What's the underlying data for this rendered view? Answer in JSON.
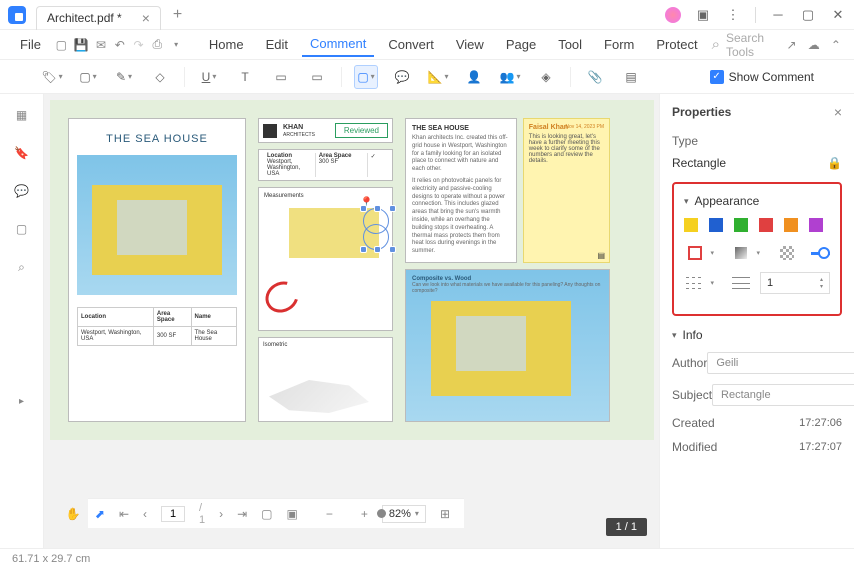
{
  "titlebar": {
    "tab_name": "Architect.pdf *"
  },
  "menubar": {
    "file": "File",
    "items": [
      "Home",
      "Edit",
      "Comment",
      "Convert",
      "View",
      "Page",
      "Tool",
      "Form",
      "Protect"
    ],
    "active_index": 2,
    "search_placeholder": "Search Tools"
  },
  "toolbar": {
    "show_comment": "Show Comment"
  },
  "document": {
    "sea_house_title": "THE SEA HOUSE",
    "khan": "KHAN",
    "architects": "ARCHITECTS",
    "reviewed": "Reviewed",
    "location_hdr": "Location",
    "area_hdr": "Area Space",
    "name_hdr": "Name",
    "location_val": "Westport,\nWashington, USA",
    "area_val": "300 SF",
    "name_val": "The Sea House",
    "measurements": "Measurements",
    "isometric": "Isometric",
    "desc_title": "THE SEA HOUSE",
    "desc_text": "Khan architects Inc. created this off-grid house in Westport, Washington for a family looking for an isolated place to connect with nature and each other.",
    "desc_text2": "It relies on photovoltaic panels for electricity and passive-cooling designs to operate without a power connection. This includes glazed areas that bring the sun's warmth inside, while an overhang the building stops it overheating. A thermal mass protects them from heat loss during evenings in the summer.",
    "sticky_name": "Faisal Khan",
    "sticky_date": "Nov 14, 2023 PM",
    "sticky_body": "This is looking great, let's have a further meeting this week to clarify some of the numbers and review the details.",
    "composite_title": "Composite vs. Wood",
    "composite_sub": "Can we look into what materials we have available for this paneling? Any thoughts on composite?",
    "page_indicator": "1 / 1"
  },
  "properties": {
    "title": "Properties",
    "type_label": "Type",
    "type_value": "Rectangle",
    "appearance": "Appearance",
    "width_value": "1",
    "info": "Info",
    "author_label": "Author",
    "author_value": "Geili",
    "subject_label": "Subject",
    "subject_value": "Rectangle",
    "created_label": "Created",
    "created_value": "17:27:06",
    "modified_label": "Modified",
    "modified_value": "17:27:07"
  },
  "bottombar": {
    "page_current": "1",
    "page_total": "/ 1",
    "zoom": "82%"
  },
  "statusbar": {
    "dimensions": "61.71 x 29.7 cm"
  }
}
